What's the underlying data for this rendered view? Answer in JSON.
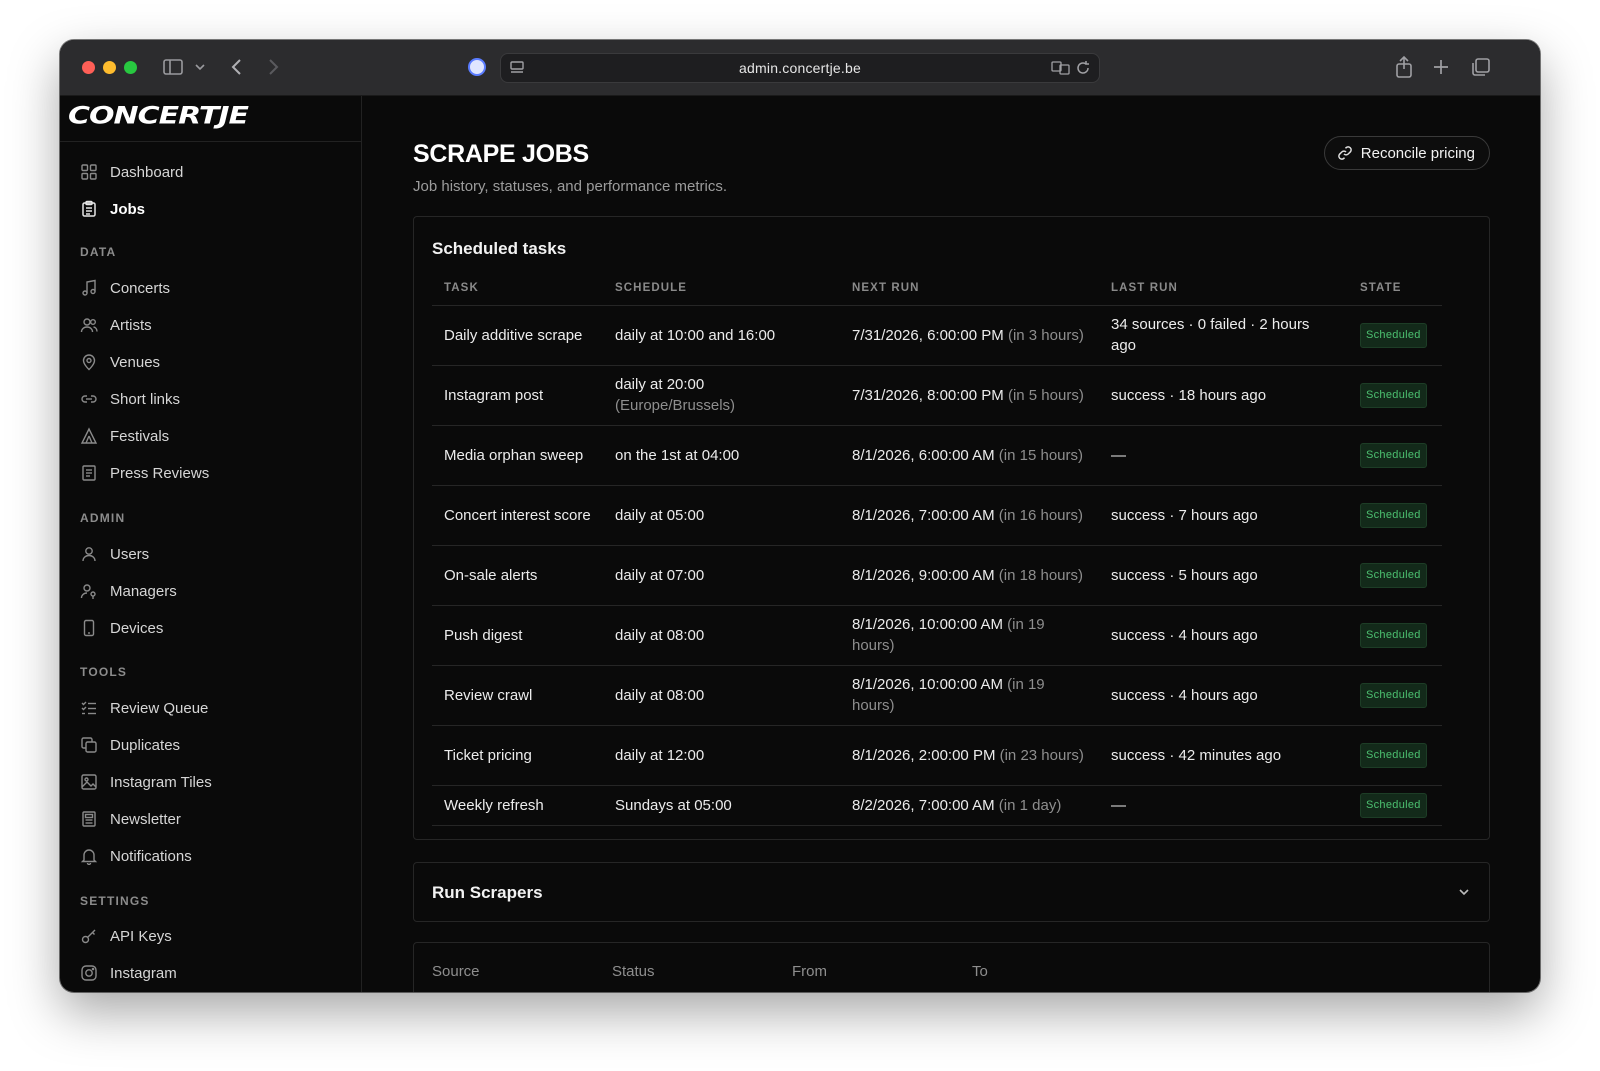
{
  "browser": {
    "url": "admin.concertje.be"
  },
  "sidebar": {
    "logo": "CONCERTJE",
    "top_items": [
      {
        "label": "Dashboard",
        "icon": "grid-icon"
      },
      {
        "label": "Jobs",
        "icon": "clipboard-icon",
        "active": true
      }
    ],
    "sections": [
      {
        "label": "DATA",
        "items": [
          {
            "label": "Concerts",
            "icon": "music-note-icon"
          },
          {
            "label": "Artists",
            "icon": "users-icon"
          },
          {
            "label": "Venues",
            "icon": "map-pin-icon"
          },
          {
            "label": "Short links",
            "icon": "link-icon"
          },
          {
            "label": "Festivals",
            "icon": "tent-icon"
          },
          {
            "label": "Press Reviews",
            "icon": "newspaper-icon"
          }
        ]
      },
      {
        "label": "ADMIN",
        "items": [
          {
            "label": "Users",
            "icon": "user-icon"
          },
          {
            "label": "Managers",
            "icon": "user-key-icon"
          },
          {
            "label": "Devices",
            "icon": "smartphone-icon"
          }
        ]
      },
      {
        "label": "TOOLS",
        "items": [
          {
            "label": "Review Queue",
            "icon": "list-check-icon"
          },
          {
            "label": "Duplicates",
            "icon": "copy-icon"
          },
          {
            "label": "Instagram Tiles",
            "icon": "image-grid-icon"
          },
          {
            "label": "Newsletter",
            "icon": "newsletter-icon"
          },
          {
            "label": "Notifications",
            "icon": "bell-icon"
          }
        ]
      },
      {
        "label": "SETTINGS",
        "items": [
          {
            "label": "API Keys",
            "icon": "key-icon"
          },
          {
            "label": "Instagram",
            "icon": "instagram-icon"
          }
        ]
      }
    ]
  },
  "header": {
    "title": "SCRAPE JOBS",
    "subtitle": "Job history, statuses, and performance metrics.",
    "reconcile_label": "Reconcile pricing"
  },
  "scheduled": {
    "title": "Scheduled tasks",
    "columns": [
      "TASK",
      "SCHEDULE",
      "NEXT RUN",
      "LAST RUN",
      "STATE"
    ],
    "rows": [
      {
        "task": "Daily additive scrape",
        "schedule": "daily at 10:00 and 16:00",
        "schedule_tz": "",
        "next": "7/31/2026, 6:00:00 PM",
        "next_rel": "(in 3 hours)",
        "last": "34 sources · 0 failed · 2 hours ago",
        "state": "Scheduled"
      },
      {
        "task": "Instagram post",
        "schedule": "daily at 20:00",
        "schedule_tz": "(Europe/Brussels)",
        "next": "7/31/2026, 8:00:00 PM",
        "next_rel": "(in 5 hours)",
        "last": "success · 18 hours ago",
        "state": "Scheduled"
      },
      {
        "task": "Media orphan sweep",
        "schedule": "on the 1st at 04:00",
        "schedule_tz": "",
        "next": "8/1/2026, 6:00:00 AM",
        "next_rel": "(in 15 hours)",
        "last": "—",
        "state": "Scheduled"
      },
      {
        "task": "Concert interest score",
        "schedule": "daily at 05:00",
        "schedule_tz": "",
        "next": "8/1/2026, 7:00:00 AM",
        "next_rel": "(in 16 hours)",
        "last": "success · 7 hours ago",
        "state": "Scheduled"
      },
      {
        "task": "On-sale alerts",
        "schedule": "daily at 07:00",
        "schedule_tz": "",
        "next": "8/1/2026, 9:00:00 AM",
        "next_rel": "(in 18 hours)",
        "last": "success · 5 hours ago",
        "state": "Scheduled"
      },
      {
        "task": "Push digest",
        "schedule": "daily at 08:00",
        "schedule_tz": "",
        "next": "8/1/2026, 10:00:00 AM",
        "next_rel": "(in 19 hours)",
        "last": "success · 4 hours ago",
        "state": "Scheduled"
      },
      {
        "task": "Review crawl",
        "schedule": "daily at 08:00",
        "schedule_tz": "",
        "next": "8/1/2026, 10:00:00 AM",
        "next_rel": "(in 19 hours)",
        "last": "success · 4 hours ago",
        "state": "Scheduled"
      },
      {
        "task": "Ticket pricing",
        "schedule": "daily at 12:00",
        "schedule_tz": "",
        "next": "8/1/2026, 2:00:00 PM",
        "next_rel": "(in 23 hours)",
        "last": "success · 42 minutes ago",
        "state": "Scheduled"
      },
      {
        "task": "Weekly refresh",
        "schedule": "Sundays at 05:00",
        "schedule_tz": "",
        "next": "8/2/2026, 7:00:00 AM",
        "next_rel": "(in 1 day)",
        "last": "—",
        "state": "Scheduled"
      }
    ]
  },
  "run_scrapers": {
    "title": "Run Scrapers"
  },
  "history": {
    "columns": [
      "Source",
      "Status",
      "From",
      "To"
    ]
  },
  "colors": {
    "background": "#0a0a0a",
    "badge_text": "#4cc070",
    "badge_bg": "#132a1a"
  }
}
